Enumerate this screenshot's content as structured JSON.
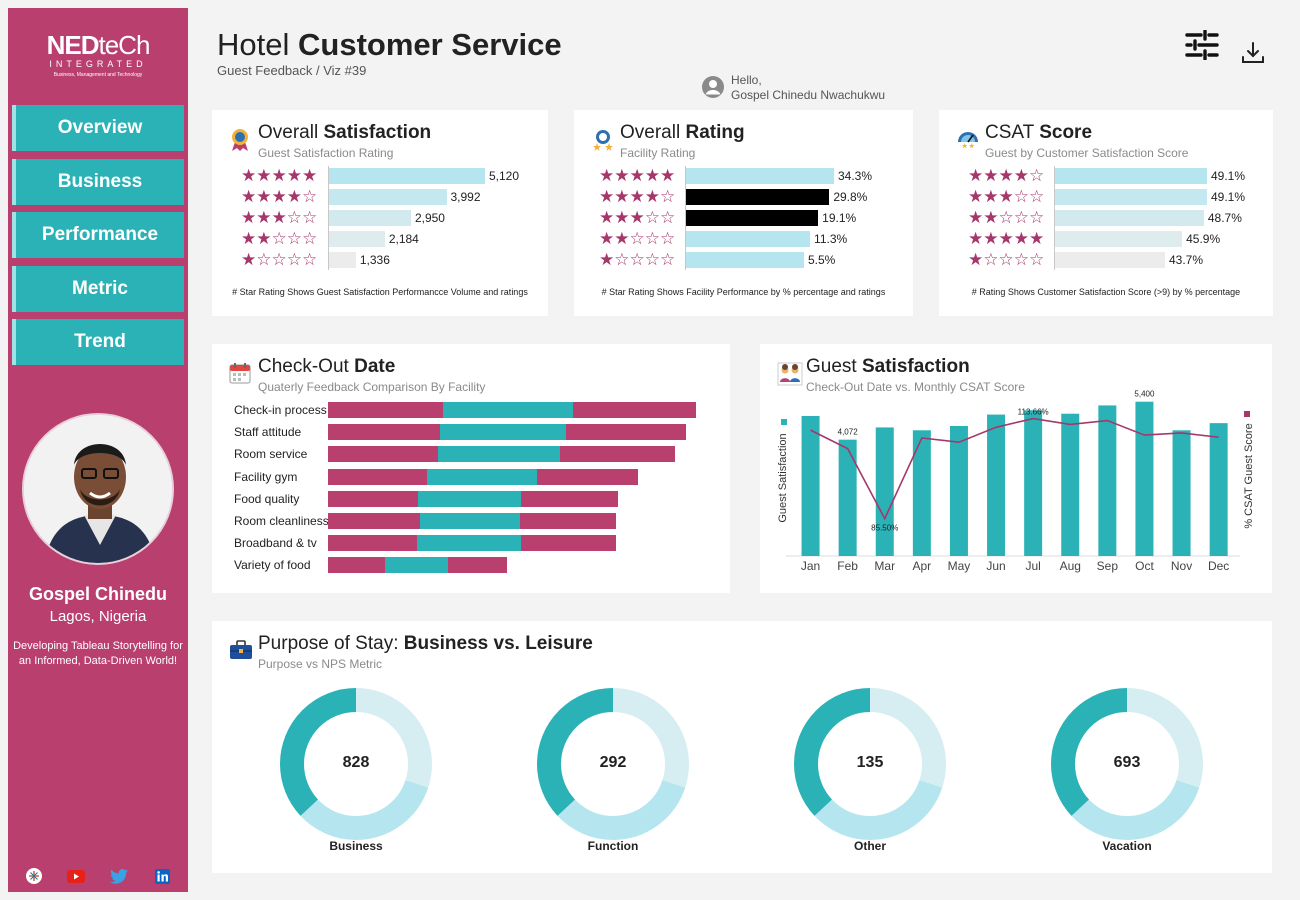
{
  "brand": {
    "part1": "NED",
    "part2": "teCh",
    "line2": "INTEGRATED",
    "line3": "Business, Management and Technology"
  },
  "nav": [
    {
      "label": "Overview"
    },
    {
      "label": "Business"
    },
    {
      "label": "Performance"
    },
    {
      "label": "Metric"
    },
    {
      "label": "Trend"
    }
  ],
  "profile": {
    "name": "Gospel Chinedu",
    "location": "Lagos, Nigeria",
    "tagline": "Developing Tableau Storytelling for an Informed, Data-Driven World!"
  },
  "social": [
    "tableau-icon",
    "youtube-icon",
    "twitter-icon",
    "linkedin-icon"
  ],
  "header": {
    "title_light": "Hotel",
    "title_bold": "Customer Service",
    "subtitle": "Guest Feedback / Viz #39",
    "hello": "Hello,",
    "user": "Gospel Chinedu Nwachukwu"
  },
  "colors": {
    "magenta": "#b83f6e",
    "teal": "#2bb2b6",
    "light_teal": "#b5e6ef",
    "pale": "#d6eef1"
  },
  "satisfaction": {
    "title_light": "Overall",
    "title_bold": "Satisfaction",
    "subtitle": "Guest Satisfaction Rating",
    "footnote": "# Star Rating Shows Guest Satisfaction Performancce Volume and ratings",
    "rows": [
      {
        "stars": 5,
        "value": 5120,
        "label": "5,120"
      },
      {
        "stars": 4,
        "value": 3992,
        "label": "3,992"
      },
      {
        "stars": 3,
        "value": 2950,
        "label": "2,950"
      },
      {
        "stars": 2,
        "value": 2184,
        "label": "2,184"
      },
      {
        "stars": 1,
        "value": 1336,
        "label": "1,336"
      }
    ]
  },
  "rating": {
    "title_light": "Overall",
    "title_bold": "Rating",
    "subtitle": "Facility Rating",
    "footnote": "# Star Rating Shows Facility Performance by % percentage and ratings",
    "rows": [
      {
        "stars": 5,
        "value": 34.3,
        "label": "34.3%",
        "highlight": false
      },
      {
        "stars": 4,
        "value": 29.8,
        "label": "29.8%",
        "highlight": true
      },
      {
        "stars": 3,
        "value": 19.1,
        "label": "19.1%",
        "highlight": true
      },
      {
        "stars": 2,
        "value": 11.3,
        "label": "11.3%",
        "highlight": false
      },
      {
        "stars": 1,
        "value": 5.5,
        "label": "5.5%",
        "highlight": false
      }
    ]
  },
  "csat": {
    "title_light": "CSAT",
    "title_bold": "Score",
    "subtitle": "Guest  by Customer Satisfaction Score",
    "footnote": "# Rating Shows Customer Satisfaction Score (>9) by % percentage",
    "rows": [
      {
        "stars": 4,
        "value": 49.1,
        "label": "49.1%"
      },
      {
        "stars": 3,
        "value": 49.1,
        "label": "49.1%"
      },
      {
        "stars": 2,
        "value": 48.7,
        "label": "48.7%"
      },
      {
        "stars": 5,
        "value": 45.9,
        "label": "45.9%"
      },
      {
        "stars": 1,
        "value": 43.7,
        "label": "43.7%"
      }
    ]
  },
  "checkout": {
    "title_light": "Check-Out",
    "title_bold": "Date",
    "subtitle": "Quaterly Feedback Comparison By Facility"
  },
  "guest": {
    "title_light": "Guest",
    "title_bold": "Satisfaction",
    "subtitle": "Check-Out Date vs. Monthly CSAT Score"
  },
  "purpose": {
    "title_light": "Purpose of Stay:",
    "title_bold": "Business vs. Leisure",
    "subtitle": "Purpose vs  NPS Metric"
  },
  "chart_data": [
    {
      "type": "bar",
      "stacked": true,
      "orientation": "horizontal",
      "categories": [
        "Check-in process",
        "Staff attitude",
        "Room service",
        "Facility gym",
        "Food quality",
        "Room cleanliness",
        "Broadband & tv",
        "Variety of food"
      ],
      "series": [
        {
          "color": "#b83f6e",
          "values": [
            115,
            112,
            110,
            99,
            90,
            92,
            89,
            57
          ]
        },
        {
          "color": "#2bb2b6",
          "values": [
            130,
            126,
            122,
            110,
            103,
            100,
            104,
            63
          ]
        },
        {
          "color": "#b83f6e",
          "values": [
            123,
            120,
            115,
            101,
            97,
            96,
            95,
            59
          ]
        }
      ]
    },
    {
      "type": "bar",
      "title": "Guest Satisfaction",
      "xlabel": "",
      "ylabel": "Guest Satisfaction",
      "y2label": "% CSAT Guest Score",
      "categories": [
        "Jan",
        "Feb",
        "Mar",
        "Apr",
        "May",
        "Jun",
        "Jul",
        "Aug",
        "Sep",
        "Oct",
        "Nov",
        "Dec"
      ],
      "series": [
        {
          "type": "bar",
          "color": "#2bb2b6",
          "values": [
            4900,
            4072,
            4500,
            4400,
            4550,
            4950,
            5100,
            4980,
            5270,
            5400,
            4400,
            4650
          ]
        },
        {
          "type": "line",
          "color": "#a6376b",
          "values": [
            110.4,
            105.2,
            85.5,
            108.2,
            107.0,
            111.2,
            113.66,
            112.0,
            113.1,
            109.0,
            109.6,
            108.4
          ]
        }
      ],
      "annotations": [
        {
          "x": "Feb",
          "label": "4,072"
        },
        {
          "x": "Mar",
          "label": "85.50%"
        },
        {
          "x": "Jul",
          "label": "113.66%"
        },
        {
          "x": "Oct",
          "label": "5,400"
        }
      ],
      "ylim": [
        0,
        5600
      ],
      "y2lim": [
        75,
        120
      ]
    },
    {
      "type": "pie",
      "subtype": "donut",
      "items": [
        {
          "label": "Business",
          "value": 828,
          "value_label": "828",
          "shares": [
            0.37,
            0.33,
            0.3
          ]
        },
        {
          "label": "Function",
          "value": 292,
          "value_label": "292",
          "shares": [
            0.37,
            0.33,
            0.3
          ]
        },
        {
          "label": "Other",
          "value": 135,
          "value_label": "135",
          "shares": [
            0.37,
            0.33,
            0.3
          ]
        },
        {
          "label": "Vacation",
          "value": 693,
          "value_label": "693",
          "shares": [
            0.37,
            0.33,
            0.3
          ]
        }
      ],
      "segment_colors": [
        "#2bb2b6",
        "#b5e6ef",
        "#d6eef1"
      ]
    }
  ]
}
